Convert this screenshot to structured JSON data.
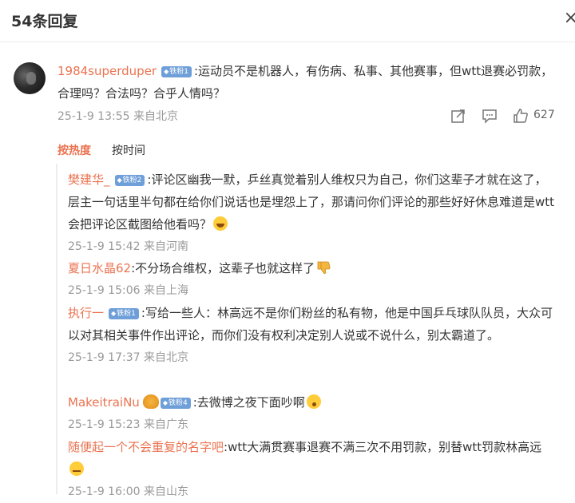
{
  "header": {
    "title": "54条回复",
    "close": "×"
  },
  "main_comment": {
    "user": "1984superduper",
    "badge": "铁粉1",
    "text": ":运动员不是机器人，有伤病、私事、其他赛事，但wtt退赛必罚款，合理吗？合法吗？合乎人情吗？",
    "time": "25-1-9 13:55",
    "location": "来自北京",
    "likes": "627"
  },
  "sort": {
    "hot": "按热度",
    "time": "按时间"
  },
  "replies": [
    {
      "user": "樊建华_",
      "badge": "铁粉2",
      "text": ":评论区幽我一默，乒丝真觉着别人维权只为自己，你们这辈子才就在这了，层主一句话里半句都在给你们说话也是埋怨上了，那请问你们评论的那些好好休息难道是wtt会把评论区截图给他看吗？",
      "time": "25-1-9 15:42",
      "location": "来自河南"
    },
    {
      "user": "夏日水晶62",
      "badge": "",
      "text": ":不分场合维权，这辈子也就这样了",
      "time": "25-1-9 15:06",
      "location": "来自上海"
    },
    {
      "user": "执行一",
      "badge": "铁粉1",
      "text": ":写给一些人：林高远不是你们粉丝的私有物，他是中国乒乓球队队员，大众可以对其相关事件作出评论，而你们没有权利决定别人说或不说什么，别太霸道了。",
      "time": "25-1-9 17:37",
      "location": "来自北京"
    },
    {
      "user": "MakeitraiNu",
      "badge": "铁粉4",
      "text": ":去微博之夜下面吵啊",
      "time": "25-1-9 15:23",
      "location": "来自广东"
    },
    {
      "user": "随便起一个不会重复的名字吧",
      "badge": "",
      "text": ":wtt大满贯赛事退赛不满三次不用罚款，别替wtt罚款林高远",
      "time": "25-1-9 16:00",
      "location": "来自山东"
    }
  ]
}
